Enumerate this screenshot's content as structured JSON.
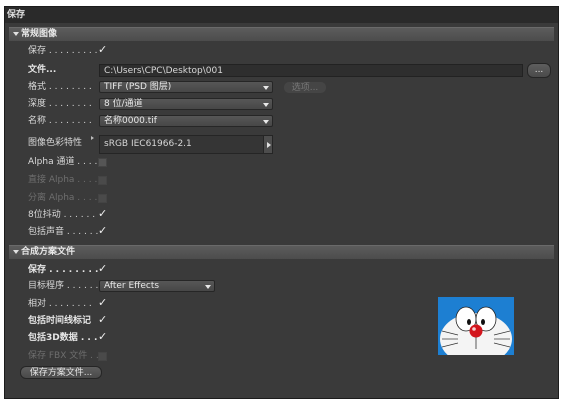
{
  "window": {
    "title": "保存"
  },
  "section_general": {
    "header": "常规图像",
    "save_label": "保存 . . . . . . . . .",
    "save_checked": true,
    "file_label": "文件...",
    "file_path": "C:\\Users\\CPC\\Desktop\\001",
    "browse_button": "...",
    "format_label": "格式 . . . . . . . .",
    "format_value": "TIFF (PSD 图层)",
    "options_button": "选项...",
    "depth_label": "深度 . . . . . . . .",
    "depth_value": "8 位/通道",
    "name_label": "名称 . . . . . . . .",
    "name_value": "名称0000.tif",
    "color_profile_label": "图像色彩特性",
    "color_profile_value": "sRGB IEC61966-2.1",
    "alpha_label": "Alpha 通道 . . . .",
    "alpha_checked": false,
    "straight_alpha_label": "直接 Alpha . . . .",
    "straight_alpha_checked": false,
    "separate_alpha_label": "分离 Alpha . . . .",
    "separate_alpha_checked": false,
    "dither_label": "8位抖动 . . . . . .",
    "dither_checked": true,
    "sound_label": "包括声音 . . . . . .",
    "sound_checked": true
  },
  "section_composition": {
    "header": "合成方案文件",
    "save_label": "保存 . . . . . . . . .",
    "save_checked": true,
    "target_label": "目标程序 . . . . . .",
    "target_value": "After Effects",
    "relative_label": "相对 . . . . . . . .",
    "relative_checked": true,
    "timeline_markers_label": "包括时间线标记",
    "timeline_markers_checked": true,
    "include_3d_label": "包括3D数据 . . .",
    "include_3d_checked": true,
    "fbx_label": "保存 FBX 文件 . . .",
    "fbx_checked": false,
    "save_project_button": "保存方案文件..."
  },
  "colors": {
    "panel_bg": "#3a3a3a",
    "header_bg": "#555555",
    "doraemon_blue": "#1d7fd2",
    "doraemon_nose": "#d3151d"
  }
}
